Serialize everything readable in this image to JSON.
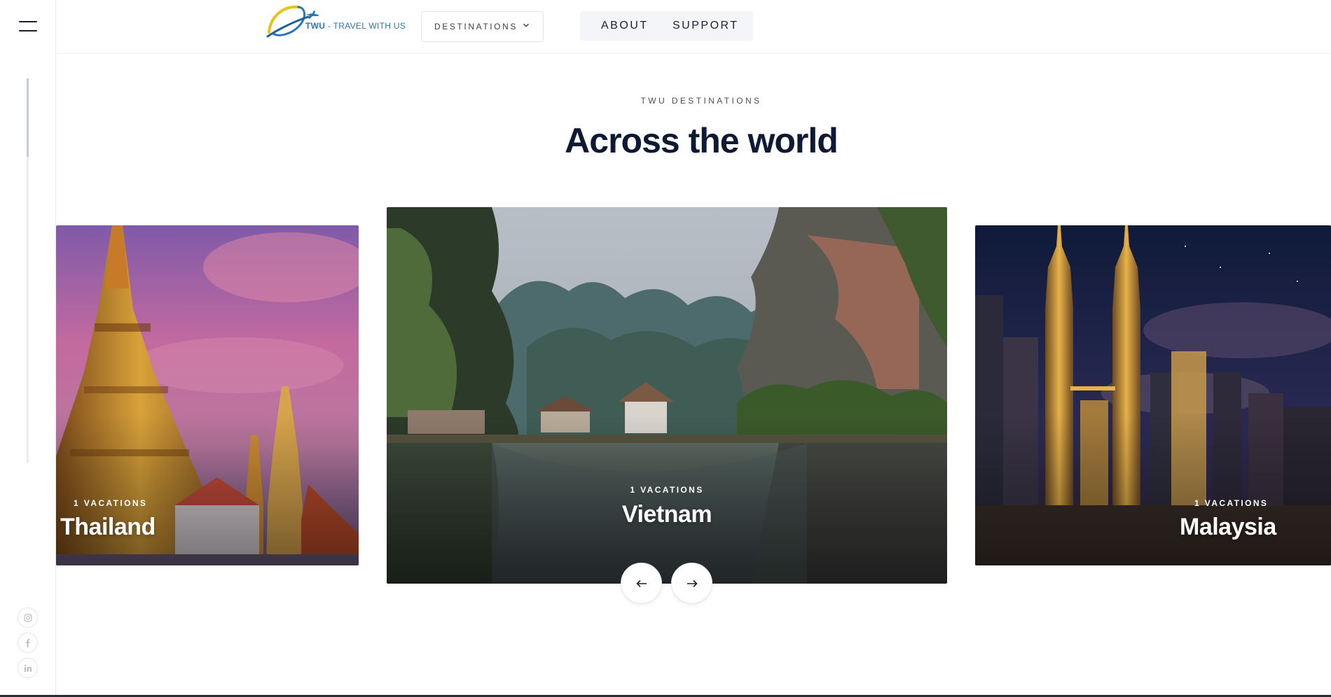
{
  "header": {
    "logo_bold": "TWU",
    "logo_tagline": "- TRAVEL WITH US",
    "destinations_label": "DESTINATIONS",
    "nav": {
      "about": "ABOUT",
      "support": "SUPPORT"
    }
  },
  "section": {
    "eyebrow": "TWU DESTINATIONS",
    "title": "Across the world"
  },
  "cards": [
    {
      "count": "1 VACATIONS",
      "name": "Thailand"
    },
    {
      "count": "1 VACATIONS",
      "name": "Vietnam"
    },
    {
      "count": "1 VACATIONS",
      "name": "Malaysia"
    }
  ],
  "social": [
    "instagram-icon",
    "facebook-icon",
    "linkedin-icon"
  ],
  "colors": {
    "title": "#0e1a33",
    "logo_blue": "#2b76b9",
    "logo_yellow": "#e7c21a"
  }
}
